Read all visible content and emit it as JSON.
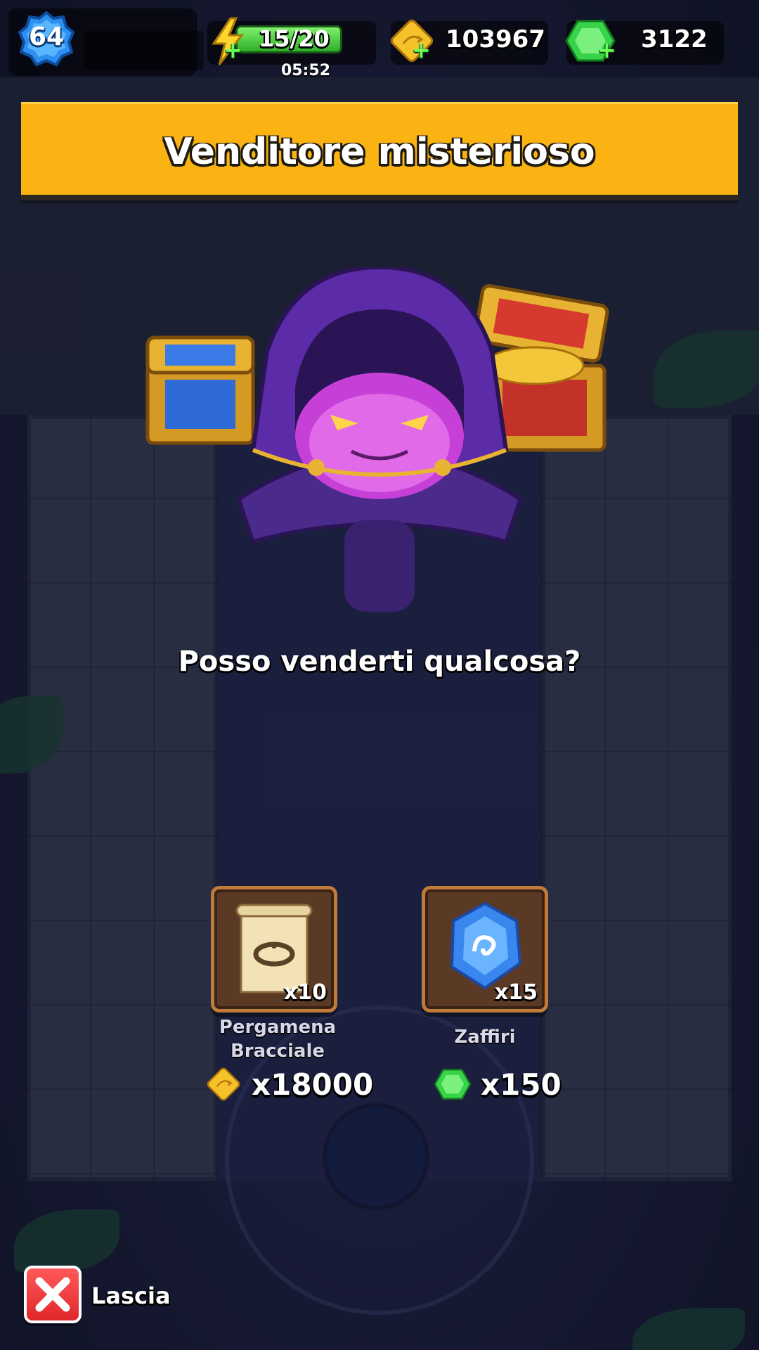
{
  "hud": {
    "player_level": "64",
    "energy": "15/20",
    "energy_fraction": 0.75,
    "energy_timer": "05:52",
    "gold": "103967",
    "gems": "3122",
    "plus_symbol": "+"
  },
  "dialog": {
    "title": "Venditore misterioso",
    "question": "Posso venderti qualcosa?"
  },
  "shop": {
    "items": [
      {
        "name": "Pergamena Bracciale",
        "quantity": "x10",
        "price": "x18000",
        "currency_icon": "gold-coin-icon",
        "item_icon": "bracelet-scroll-icon"
      },
      {
        "name": "Zaffiri",
        "quantity": "x15",
        "price": "x150",
        "currency_icon": "gem-icon",
        "item_icon": "sapphire-icon"
      }
    ]
  },
  "leave_button": {
    "label": "Lascia",
    "icon": "close-icon"
  },
  "colors": {
    "banner": "#fab313",
    "energy_green": "#3dbb34",
    "gem_green": "#37d348",
    "gold": "#f6c22a",
    "leave_red": "#e0262a",
    "card_brown": "#5a3a24"
  }
}
